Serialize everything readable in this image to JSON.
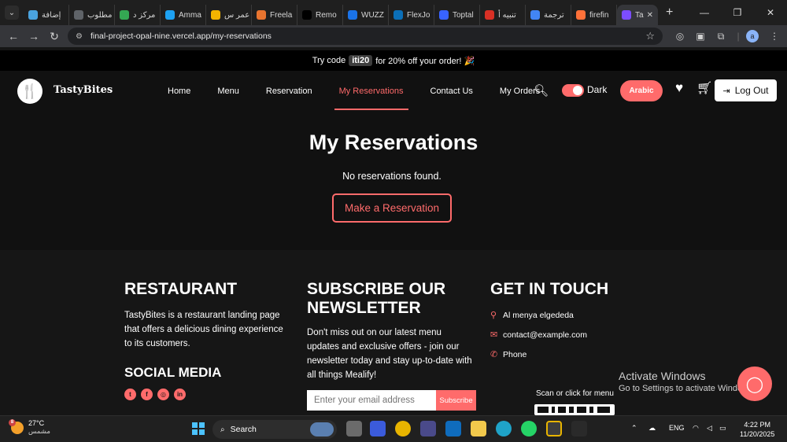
{
  "browser": {
    "tabs": [
      {
        "label": "إضافة",
        "color": "#4aa3df"
      },
      {
        "label": "مطلوب",
        "color": "#5f6368"
      },
      {
        "label": "مركز د",
        "color": "#34a853"
      },
      {
        "label": "Amma",
        "color": "#1da1f2"
      },
      {
        "label": "عمر س",
        "color": "#f4b400"
      },
      {
        "label": "Freela",
        "color": "#e8742f"
      },
      {
        "label": "Remo",
        "color": "#000000"
      },
      {
        "label": "WUZZ",
        "color": "#1a73e8"
      },
      {
        "label": "FlexJo",
        "color": "#0b6fb8"
      },
      {
        "label": "Toptal",
        "color": "#3863ff"
      },
      {
        "label": "تنبيه أ",
        "color": "#d93025"
      },
      {
        "label": "ترجمة",
        "color": "#4285f4"
      },
      {
        "label": "firefin",
        "color": "#ff7139"
      }
    ],
    "active_tab": {
      "label": "Ta",
      "color": "#7c4dff"
    },
    "url": "final-project-opal-nine.vercel.app/my-reservations",
    "profile_letter": "a"
  },
  "promo": {
    "text_before": "Try code",
    "code": "iti20",
    "text_after": "for 20% off your order! 🎉"
  },
  "header": {
    "brand": "TastyBites",
    "nav": [
      {
        "label": "Home",
        "active": false
      },
      {
        "label": "Menu",
        "active": false
      },
      {
        "label": "Reservation",
        "active": false
      },
      {
        "label": "My Reservations",
        "active": true
      },
      {
        "label": "Contact Us",
        "active": false
      },
      {
        "label": "My Orders",
        "active": false
      }
    ],
    "theme_label": "Dark",
    "language_button": "Arabic",
    "logout_label": "Log Out"
  },
  "main": {
    "title": "My Reservations",
    "empty_message": "No reservations found.",
    "cta_label": "Make a Reservation"
  },
  "footer": {
    "restaurant_heading": "RESTAURANT",
    "restaurant_desc": "TastyBites is a restaurant landing page that offers a delicious dining experience to its customers.",
    "social_heading": "SOCIAL MEDIA",
    "social_icons": [
      "twitter-icon",
      "facebook-icon",
      "instagram-icon",
      "linkedin-icon"
    ],
    "newsletter_heading": "SUBSCRIBE OUR NEWSLETTER",
    "newsletter_desc": "Don't miss out on our latest menu updates and exclusive offers - join our newsletter today and stay up-to-date with all things Mealify!",
    "email_placeholder": "Enter your email address",
    "subscribe_label": "Subscribe",
    "contact_heading": "GET IN TOUCH",
    "address": "Al menya elgededa",
    "email": "contact@example.com",
    "phone": "Phone",
    "scan_label": "Scan or click for menu"
  },
  "watermark": {
    "title": "Activate Windows",
    "subtitle": "Go to Settings to activate Windows."
  },
  "taskbar": {
    "weather_temp": "27°C",
    "weather_desc": "مشمس",
    "weather_badge": "8",
    "search_label": "Search",
    "lang": "ENG",
    "time": "4:22 PM",
    "date": "11/20/2025"
  },
  "colors": {
    "accent": "#ff6b6b",
    "background": "#111111",
    "footer_bg": "#161616"
  }
}
